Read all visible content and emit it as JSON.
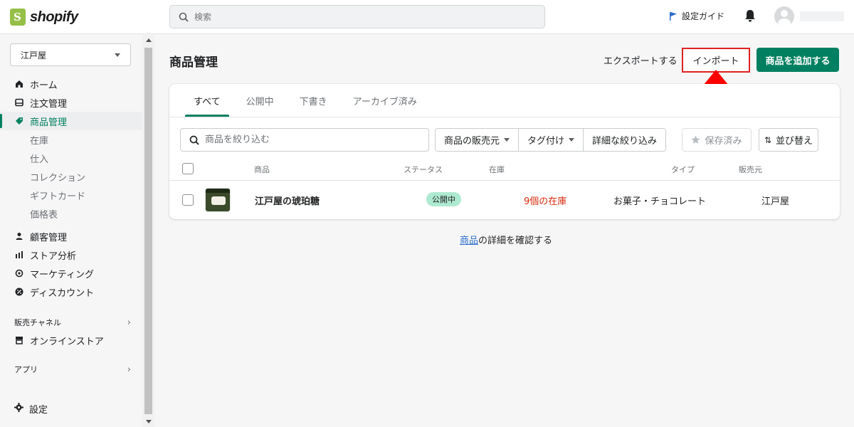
{
  "brand": {
    "name": "shopify"
  },
  "search": {
    "placeholder": "検索"
  },
  "topbar": {
    "setup_guide": "設定ガイド"
  },
  "sidebar": {
    "store": "江戸屋",
    "items": [
      {
        "label": "ホーム",
        "icon": "home-icon"
      },
      {
        "label": "注文管理",
        "icon": "inbox-icon"
      },
      {
        "label": "商品管理",
        "icon": "tag-icon",
        "active": true
      }
    ],
    "sub_items": [
      "在庫",
      "仕入",
      "コレクション",
      "ギフトカード",
      "価格表"
    ],
    "items2": [
      {
        "label": "顧客管理",
        "icon": "person-icon"
      },
      {
        "label": "ストア分析",
        "icon": "bar-chart-icon"
      },
      {
        "label": "マーケティング",
        "icon": "target-icon"
      },
      {
        "label": "ディスカウント",
        "icon": "discount-icon"
      }
    ],
    "sales_channels": "販売チャネル",
    "online_store": "オンラインストア",
    "apps": "アプリ",
    "settings": "設定"
  },
  "page": {
    "title": "商品管理",
    "export": "エクスポートする",
    "import": "インポート",
    "add_product": "商品を追加する"
  },
  "tabs": [
    "すべて",
    "公開中",
    "下書き",
    "アーカイブ済み"
  ],
  "filters": {
    "search_placeholder": "商品を絞り込む",
    "vendor": "商品の販売元",
    "tagged": "タグ付け",
    "more_filters": "詳細な絞り込み",
    "saved": "保存済み",
    "sort": "並び替え"
  },
  "table": {
    "headers": {
      "product": "商品",
      "status": "ステータス",
      "inventory": "在庫",
      "type": "タイプ",
      "vendor": "販売元"
    },
    "rows": [
      {
        "product": "江戸屋の琥珀糖",
        "status": "公開中",
        "inventory": "9個の在庫",
        "type": "お菓子・チョコレート",
        "vendor": "江戸屋"
      }
    ]
  },
  "footer": {
    "link": "商品",
    "text": "の詳細を確認する"
  },
  "colors": {
    "accent": "#008060",
    "highlight": "#e02020",
    "link": "#2c6ecb",
    "stock": "#d72c0d"
  }
}
